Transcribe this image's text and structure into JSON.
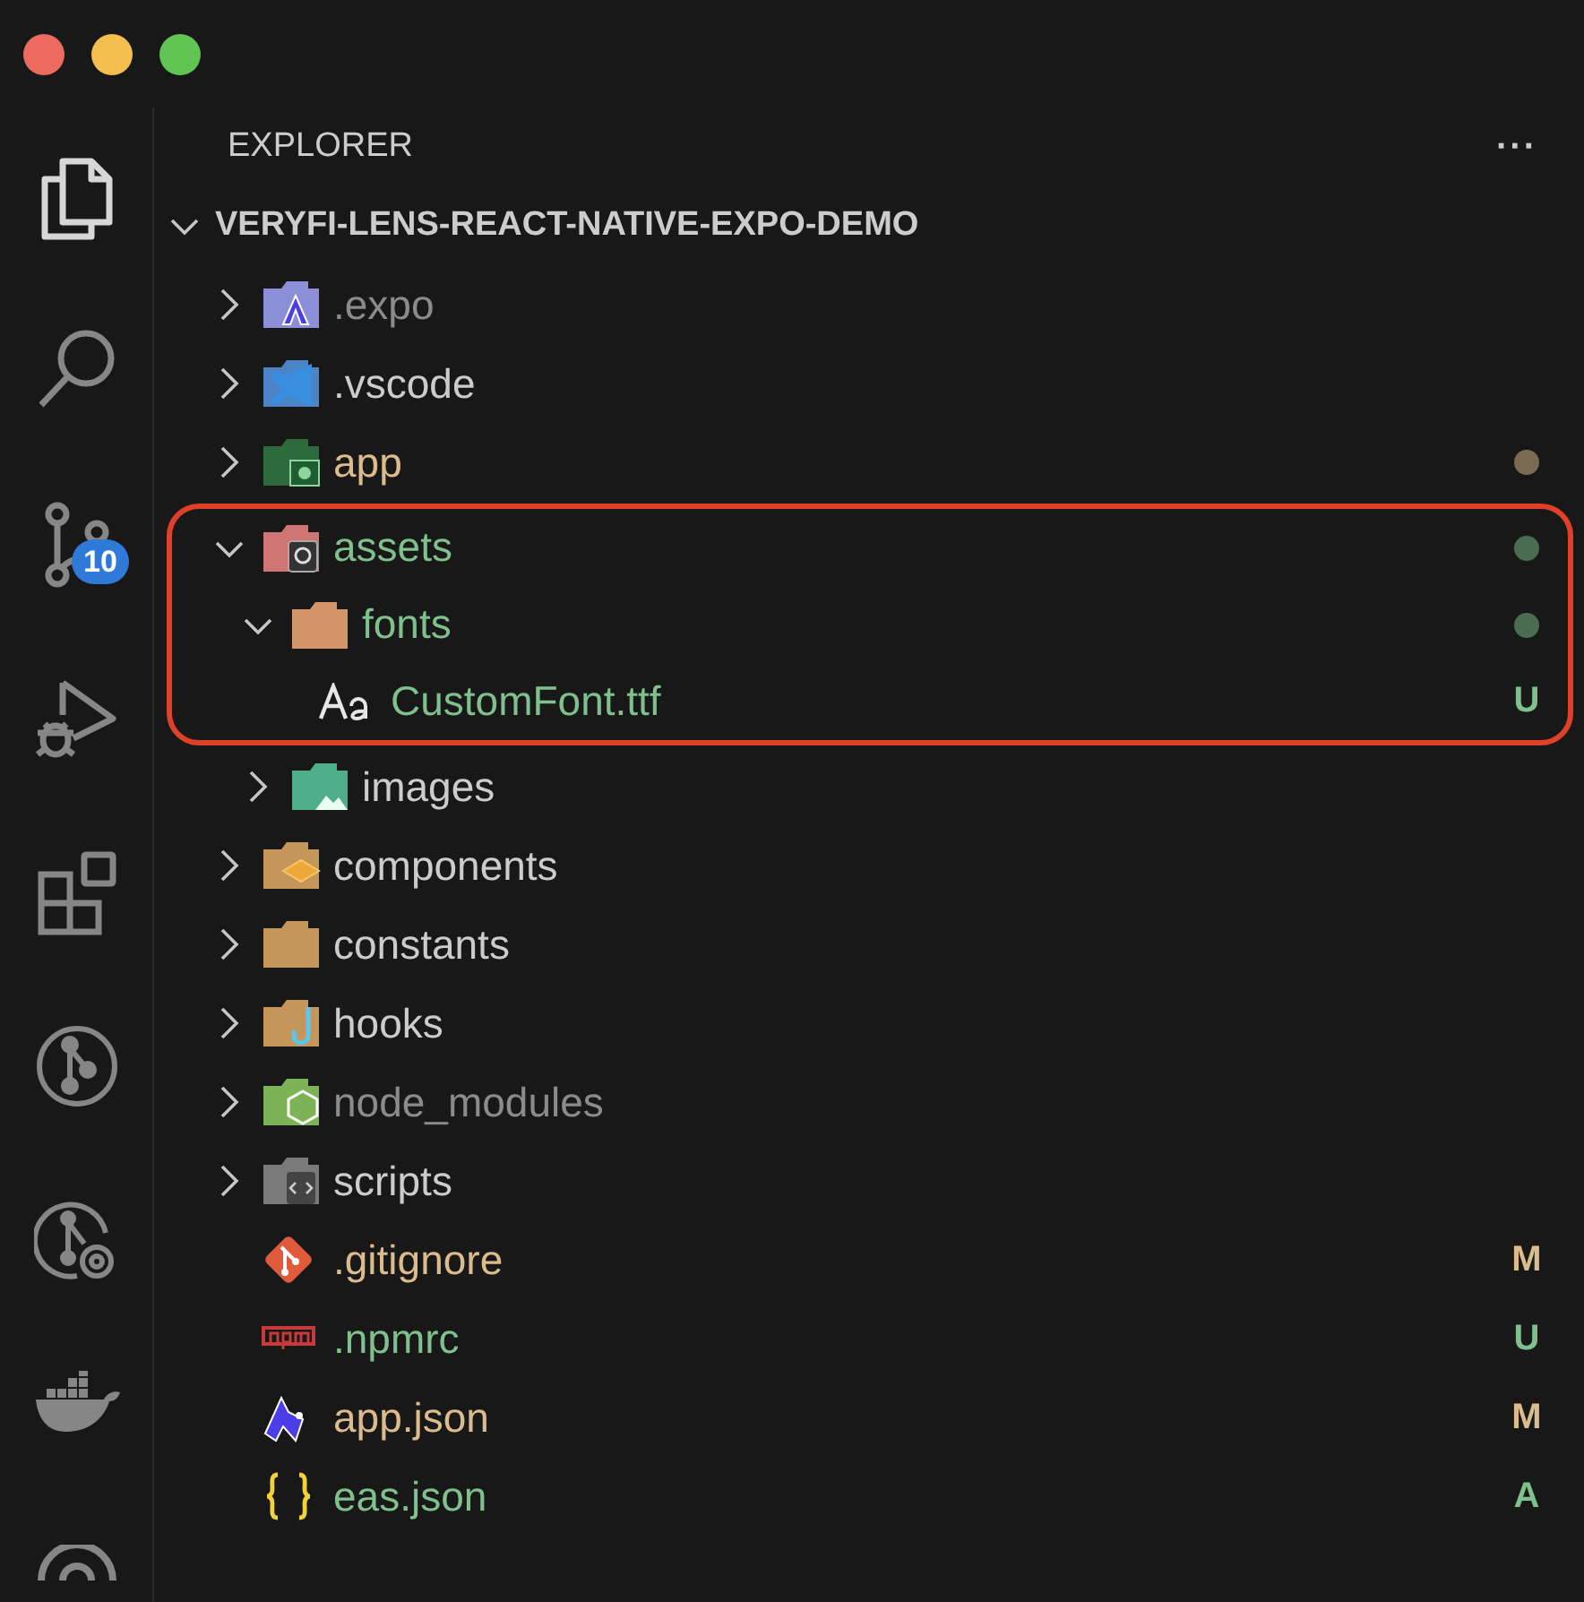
{
  "activity_bar": [
    {
      "kind": "files",
      "selected": true
    },
    {
      "kind": "search",
      "selected": false
    },
    {
      "kind": "scm",
      "selected": false,
      "badge": "10"
    },
    {
      "kind": "debug",
      "selected": false
    },
    {
      "kind": "extensions",
      "selected": false
    },
    {
      "kind": "gitgraph",
      "selected": false
    },
    {
      "kind": "gitlens",
      "selected": false
    },
    {
      "kind": "docker",
      "selected": false
    },
    {
      "kind": "remote",
      "selected": false
    }
  ],
  "sidebar": {
    "title": "EXPLORER",
    "more": "···"
  },
  "tree": {
    "root": "VERYFI-LENS-REACT-NATIVE-EXPO-DEMO",
    "expanded": true,
    "items": [
      {
        "name": ".expo",
        "kind": "expo",
        "folder": true,
        "expanded": false,
        "color": "#8b8b8b",
        "dot": false
      },
      {
        "name": ".vscode",
        "kind": "vscode",
        "folder": true,
        "expanded": false,
        "color": "#cccccc",
        "dot": false
      },
      {
        "name": "app",
        "kind": "app",
        "folder": true,
        "expanded": false,
        "color": "#dcbb8c",
        "dot": true
      },
      {
        "name": "assets",
        "kind": "assets",
        "folder": true,
        "expanded": true,
        "color": "#7fc08c",
        "dot": true,
        "highlighted": true,
        "children": [
          {
            "name": "fonts",
            "kind": "fonts",
            "folder": true,
            "expanded": true,
            "color": "#7fc08c",
            "dot": true,
            "highlighted": true,
            "children": [
              {
                "name": "CustomFont.ttf",
                "kind": "font",
                "folder": false,
                "color": "#7fc08c",
                "badge": "U",
                "highlighted": true
              }
            ]
          },
          {
            "name": "images",
            "kind": "images",
            "folder": true,
            "expanded": false,
            "color": "#cccccc",
            "dot": false,
            "highlighted": false
          }
        ]
      },
      {
        "name": "components",
        "kind": "components",
        "folder": true,
        "expanded": false,
        "color": "#cccccc",
        "dot": false
      },
      {
        "name": "constants",
        "kind": "plain",
        "folder": true,
        "expanded": false,
        "color": "#cccccc",
        "dot": false
      },
      {
        "name": "hooks",
        "kind": "hooks",
        "folder": true,
        "expanded": false,
        "color": "#cccccc",
        "dot": false
      },
      {
        "name": "node_modules",
        "kind": "node",
        "folder": true,
        "expanded": false,
        "color": "#8b8b8b",
        "dot": false
      },
      {
        "name": "scripts",
        "kind": "scripts",
        "folder": true,
        "expanded": false,
        "color": "#cccccc",
        "dot": false
      },
      {
        "name": ".gitignore",
        "kind": "git",
        "folder": false,
        "color": "#dcbb8c",
        "badge": "M"
      },
      {
        "name": ".npmrc",
        "kind": "npm",
        "folder": false,
        "color": "#7fc08c",
        "badge": "U"
      },
      {
        "name": "app.json",
        "kind": "expofile",
        "folder": false,
        "color": "#dcbb8c",
        "badge": "M"
      },
      {
        "name": "eas.json",
        "kind": "json",
        "folder": false,
        "color": "#7fc08c",
        "badge": "A"
      }
    ]
  }
}
